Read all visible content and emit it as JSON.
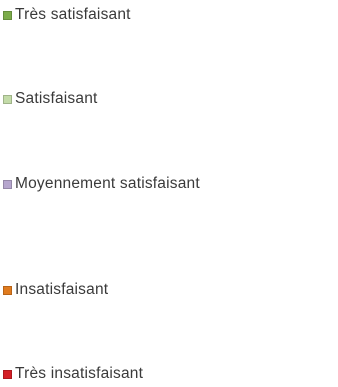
{
  "chart_data": {
    "type": "pie",
    "title": "",
    "legend": {
      "placement": "right",
      "entries": [
        {
          "label": "Très satisfaisant",
          "color": "#7cac4a"
        },
        {
          "label": "Satisfaisant",
          "color": "#c3dba8"
        },
        {
          "label": "Moyennement satisfaisant",
          "color": "#b6a6ce"
        },
        {
          "label": "Insatisfaisant",
          "color": "#e07b1e"
        },
        {
          "label": "Très insatisfaisant",
          "color": "#d41f26"
        }
      ]
    }
  }
}
